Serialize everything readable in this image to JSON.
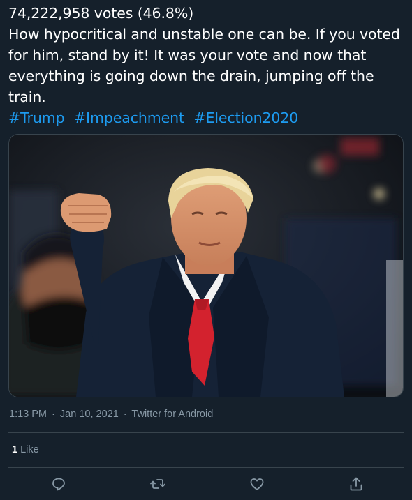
{
  "tweet": {
    "lines": [
      "74,222,958 votes (46.8%)",
      "How hypocritical and unstable one can be. If you voted for him, stand by it! It was your vote and now that everything is going down the drain, jumping off the train."
    ],
    "hashtags": [
      "#Trump",
      "#Impeachment",
      "#Election2020"
    ]
  },
  "meta": {
    "time": "1:13 PM",
    "date": "Jan 10, 2021",
    "source": "Twitter for Android",
    "separator": "·"
  },
  "engagement": {
    "like_count": "1",
    "like_label": "Like"
  },
  "actions": {
    "icons": [
      "reply-icon",
      "retweet-icon",
      "like-icon",
      "share-icon"
    ]
  },
  "colors": {
    "background": "#15202b",
    "text": "#ffffff",
    "link": "#1d9bf0",
    "muted": "#8899a6",
    "border": "#38444d"
  }
}
